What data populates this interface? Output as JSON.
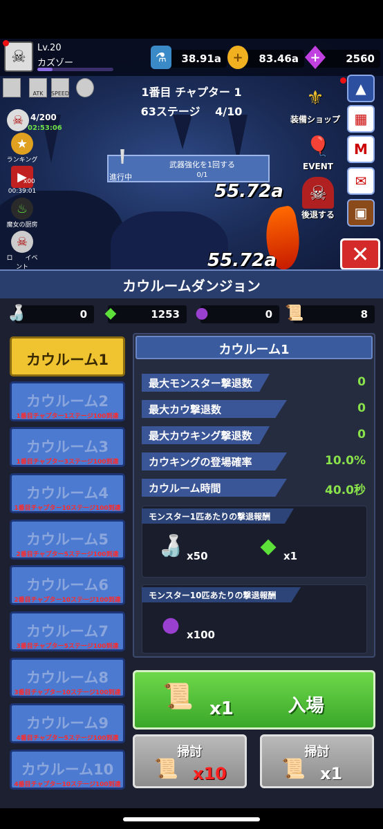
{
  "player": {
    "level": "Lv.20",
    "name": "カズゾー"
  },
  "resources": [
    {
      "icon": "potion-jar-icon",
      "value": "38.91a"
    },
    {
      "icon": "gold-coin-icon",
      "value": "83.46a"
    },
    {
      "icon": "purple-gem-icon",
      "value": "2560"
    }
  ],
  "buffs": [
    {
      "icon": "attack-buff-icon",
      "label": ""
    },
    {
      "icon": "atk-buff-icon",
      "label": "ATK"
    },
    {
      "icon": "speed-buff-icon",
      "label": "SPEED"
    },
    {
      "icon": "target-buff-icon",
      "label": ""
    }
  ],
  "chapter": {
    "line1": "1番目 チャプター 1",
    "line2": "63ステージ　 4/10"
  },
  "left_menu": {
    "capacity": "4/200",
    "capacity_timer": "02:53:06",
    "ranking": "ランキング",
    "video_timer": "00:39:01",
    "video_count": "x00",
    "witch": "魔女の厨房",
    "event_text": "ロ　　イベ ント"
  },
  "quest": {
    "status": "進行中",
    "title": "武器強化を1回する",
    "progress": "0/1"
  },
  "damage": {
    "value1": "55.72a",
    "value2": "55.72a"
  },
  "right_menu": {
    "shop": "装備ショップ",
    "event": "EVENT",
    "retreat": "後退する"
  },
  "dungeon": {
    "title": "カウルームダンジョン",
    "inventory": [
      {
        "icon": "milk-bottle-icon",
        "value": "0"
      },
      {
        "icon": "green-crystal-icon",
        "value": "1253"
      },
      {
        "icon": "dark-orb-icon",
        "value": "0"
      },
      {
        "icon": "scroll-ticket-icon",
        "value": "8"
      }
    ],
    "rooms": [
      {
        "name": "カウルーム1",
        "req": ""
      },
      {
        "name": "カウルーム2",
        "req": "1番目チャプター1ステージ100到達"
      },
      {
        "name": "カウルーム3",
        "req": "1番目チャプター3ステージ100到達"
      },
      {
        "name": "カウルーム4",
        "req": "1番目チャプター10ステージ100到達"
      },
      {
        "name": "カウルーム5",
        "req": "2番目チャプター5ステージ100到達"
      },
      {
        "name": "カウルーム6",
        "req": "2番目チャプター10ステージ100到達"
      },
      {
        "name": "カウルーム7",
        "req": "3番目チャプター5ステージ100到達"
      },
      {
        "name": "カウルーム8",
        "req": "3番目チャプター10ステージ100到達"
      },
      {
        "name": "カウルーム9",
        "req": "4番目チャプター5ステージ100到達"
      },
      {
        "name": "カウルーム10",
        "req": "4番目チャプター10ステージ100到達"
      }
    ],
    "detail": {
      "title": "カウルーム1",
      "stats": [
        {
          "label": "最大モンスター撃退数",
          "value": "0"
        },
        {
          "label": "最大カウ撃退数",
          "value": "0"
        },
        {
          "label": "最大カウキング撃退数",
          "value": "0"
        },
        {
          "label": "カウキングの登場確率",
          "value": "10.0%"
        },
        {
          "label": "カウルーム時間",
          "value": "40.0秒"
        }
      ],
      "reward1_title": "モンスター1匹あたりの撃退報酬",
      "reward1_items": [
        {
          "icon": "milk-bottle-icon",
          "count": "x50"
        },
        {
          "icon": "green-crystal-icon",
          "count": "x1"
        }
      ],
      "reward10_title": "モンスター10匹あたりの撃退報酬",
      "reward10_items": [
        {
          "icon": "dark-orb-icon",
          "count": "x100"
        }
      ]
    },
    "enter": {
      "count": "x1",
      "label": "入場"
    },
    "sweep": [
      {
        "label": "掃討",
        "count": "x10"
      },
      {
        "label": "掃討",
        "count": "x1"
      }
    ]
  }
}
